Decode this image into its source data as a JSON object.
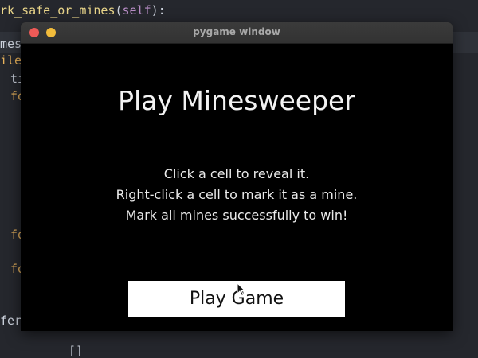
{
  "editor": {
    "line1_prefix": "rk_safe_or_mines",
    "line1_paren_open": "(",
    "line1_self": "self",
    "line1_suffix": "):",
    "line2": "mes_",
    "line3": "ile",
    "line4": "ti",
    "line5": "fo",
    "line6": "fo",
    "line7": "fo",
    "line8": "fere",
    "line9": "[]"
  },
  "window": {
    "title": "pygame window",
    "heading": "Play Minesweeper",
    "instructions": [
      "Click a cell to reveal it.",
      "Right-click a cell to mark it as a mine.",
      "Mark all mines successfully to win!"
    ],
    "play_button_label": "Play Game"
  },
  "icons": {
    "close": "close-traffic-light-icon",
    "minimize": "minimize-traffic-light-icon",
    "cursor": "mouse-pointer-icon"
  },
  "colors": {
    "close_light": "#ee5a57",
    "minimize_light": "#f2bc3b",
    "window_background": "#000000",
    "button_background": "#ffffff"
  }
}
